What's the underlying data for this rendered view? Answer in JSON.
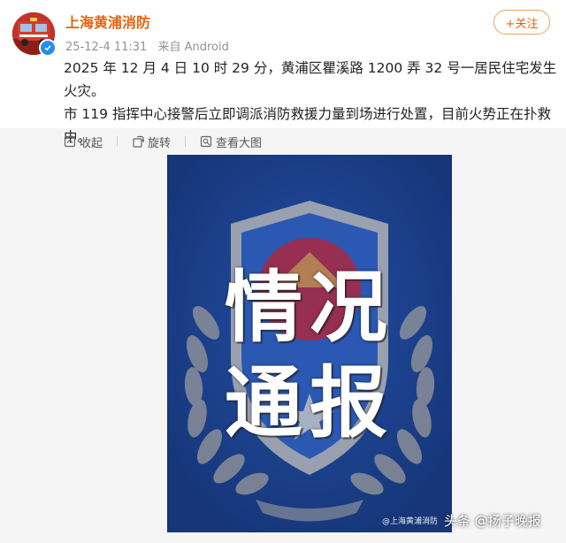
{
  "post": {
    "author": "上海黄浦消防",
    "timestamp": "25-12-4 11:31",
    "source": "来自 Android",
    "follow_label": "+关注",
    "text": "2025 年 12 月 4 日 10 时 29 分，黄浦区瞿溪路 1200 弄 32 号一居民住宅发生火灾。\n市 119 指挥中心接警后立即调派消防救援力量到场进行处置，目前火势正在扑救\n中。"
  },
  "actions": {
    "collect": "收起",
    "repost": "旋转",
    "view_full": "查看大图"
  },
  "notice_image": {
    "line1": "情况",
    "line2": "通报",
    "watermark": "@上海黄浦消防"
  },
  "footer": {
    "source_tag": "头条 @扬子晚报"
  },
  "colors": {
    "accent": "#e8630a",
    "notice_bg": "#1a3f8c",
    "verified": "#1e8ff5"
  },
  "icons": [
    "fire-truck-avatar",
    "verified-icon",
    "collapse-icon",
    "rotate-icon",
    "zoom-image-icon",
    "fire-badge-emblem"
  ]
}
